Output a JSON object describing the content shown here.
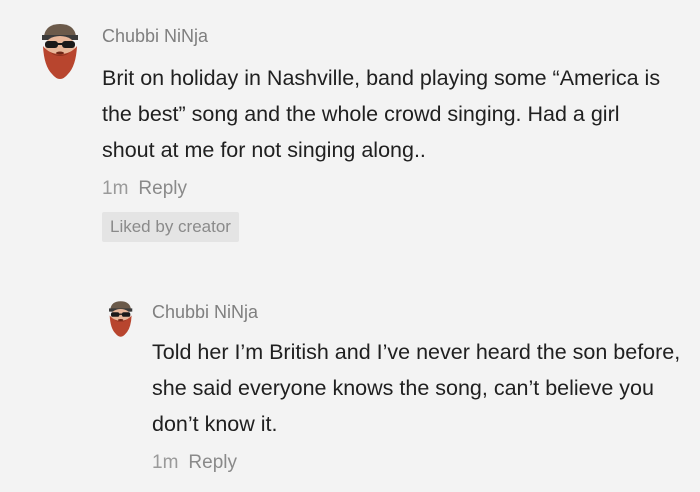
{
  "comments": [
    {
      "username": "Chubbi NiNja",
      "text": "Brit on holiday in Nashville, band playing some “America is the best” song and the whole crowd singing. Had a girl shout at me for not singing along..",
      "time": "1m",
      "reply_label": "Reply",
      "badge": "Liked by creator",
      "avatar_icon": "bearded-ninja-avatar-icon"
    },
    {
      "username": "Chubbi NiNja",
      "text": "Told her I’m British and I’ve never heard the son before, she said everyone knows the song, can’t believe you don’t know it.",
      "time": "1m",
      "reply_label": "Reply",
      "avatar_icon": "bearded-ninja-avatar-icon"
    }
  ],
  "colors": {
    "background": "#f3f3f3",
    "username": "#7f7f7f",
    "text": "#202020",
    "meta": "#9a9a9a",
    "badge_bg": "#e4e4e4",
    "beard": "#b8452e"
  }
}
